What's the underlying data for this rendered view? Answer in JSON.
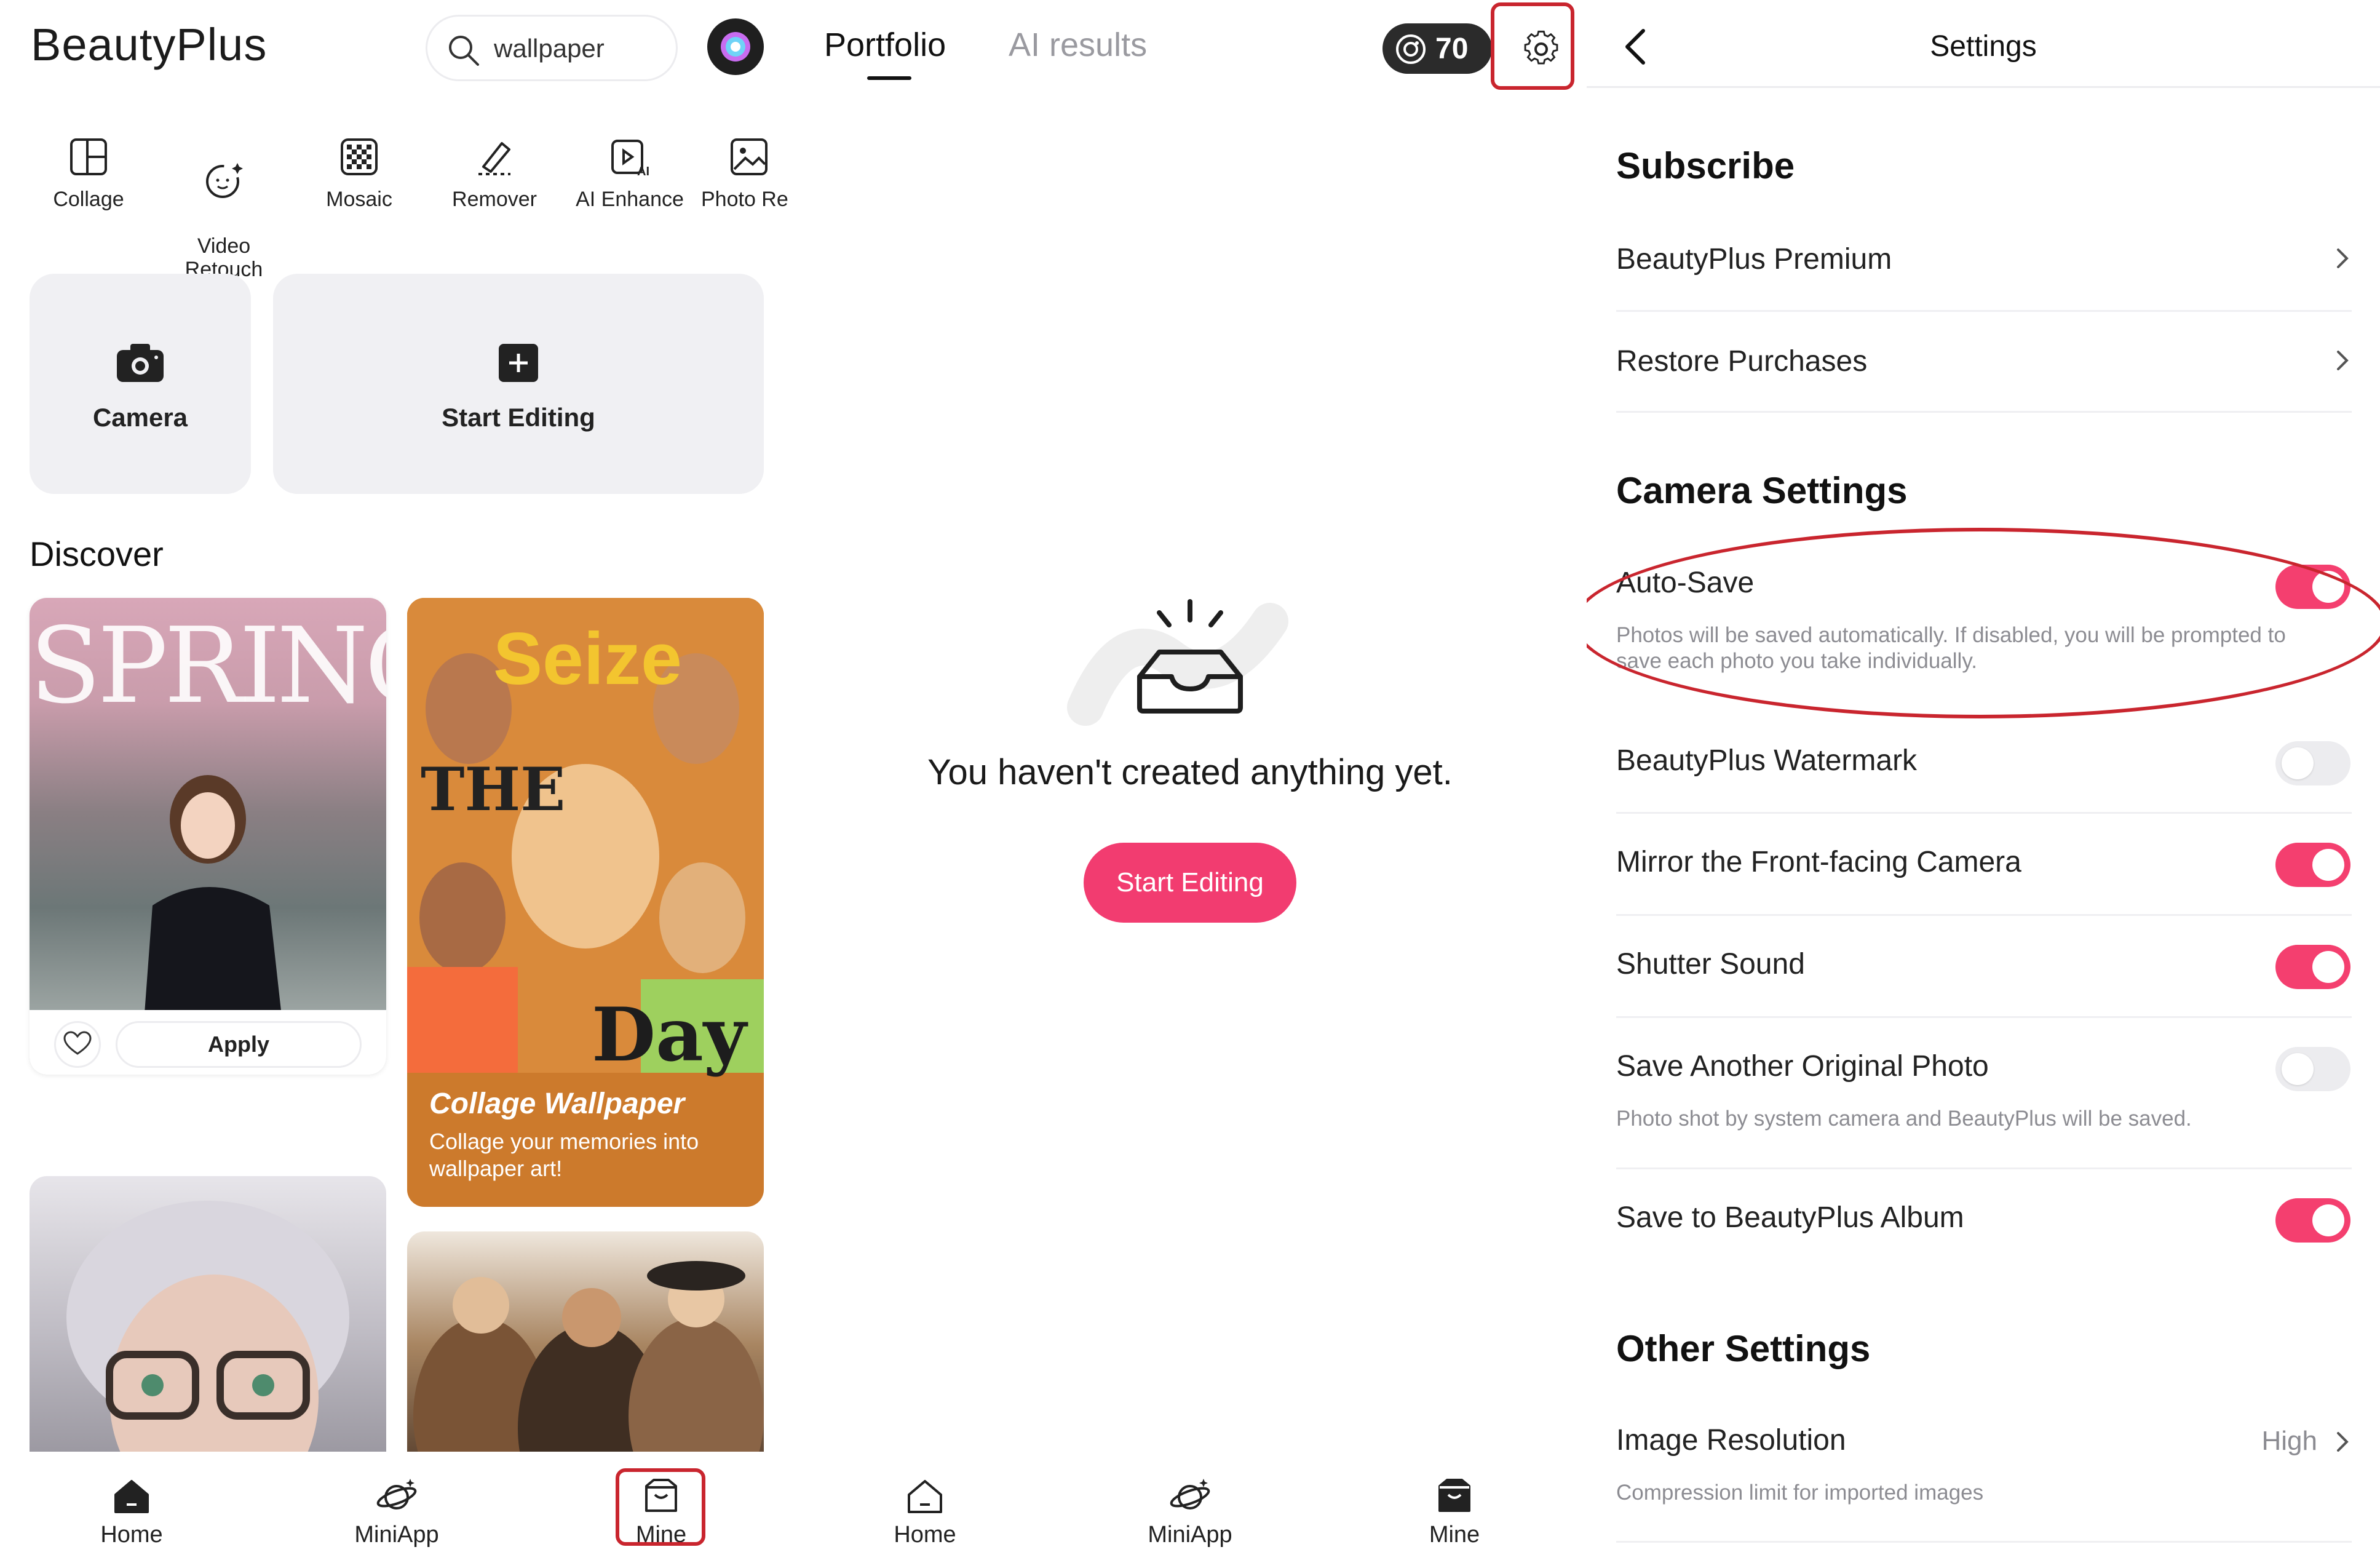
{
  "home": {
    "brand": "BeautyPlus",
    "search_text": "wallpaper",
    "tools": [
      {
        "label": "Collage",
        "icon": "collage-icon"
      },
      {
        "label": "Video\nRetouch",
        "icon": "video-retouch-icon"
      },
      {
        "label": "Mosaic",
        "icon": "mosaic-icon"
      },
      {
        "label": "Remover",
        "icon": "eraser-icon"
      },
      {
        "label": "AI Enhance",
        "icon": "ai-enhance-icon"
      },
      {
        "label": "Photo Re",
        "icon": "photo-icon"
      }
    ],
    "camera_label": "Camera",
    "start_editing_label": "Start Editing",
    "discover_label": "Discover",
    "card1_overlay": "SPRING",
    "apply_label": "Apply",
    "card2_title": "Collage Wallpaper",
    "card2_subtitle": "Collage your memories into wallpaper art!",
    "card2_words": [
      "Seize",
      "THE",
      "Day"
    ],
    "tabs": [
      "Home",
      "MiniApp",
      "Mine"
    ]
  },
  "portfolio": {
    "tab_active": "Portfolio",
    "tab_inactive": "AI results",
    "coin_count": "70",
    "empty_message": "You haven't created anything yet.",
    "start_editing_label": "Start Editing",
    "tabs": [
      "Home",
      "MiniApp",
      "Mine"
    ]
  },
  "settings": {
    "title": "Settings",
    "subscribe_header": "Subscribe",
    "premium_label": "BeautyPlus Premium",
    "restore_label": "Restore Purchases",
    "camera_header": "Camera Settings",
    "autosave_label": "Auto-Save",
    "autosave_desc": "Photos will be saved automatically. If disabled, you will be prompted to save each photo you take individually.",
    "autosave_on": true,
    "watermark_label": "BeautyPlus Watermark",
    "watermark_on": false,
    "mirror_label": "Mirror the Front-facing Camera",
    "mirror_on": true,
    "shutter_label": "Shutter Sound",
    "shutter_on": true,
    "original_label": "Save Another Original Photo",
    "original_desc": "Photo shot by system camera and BeautyPlus will be saved.",
    "original_on": false,
    "album_label": "Save to BeautyPlus Album",
    "album_on": true,
    "other_header": "Other Settings",
    "resolution_label": "Image Resolution",
    "resolution_value": "High",
    "resolution_desc": "Compression limit for imported images"
  },
  "colors": {
    "accent": "#f43f6f",
    "highlight": "#c9252e"
  }
}
